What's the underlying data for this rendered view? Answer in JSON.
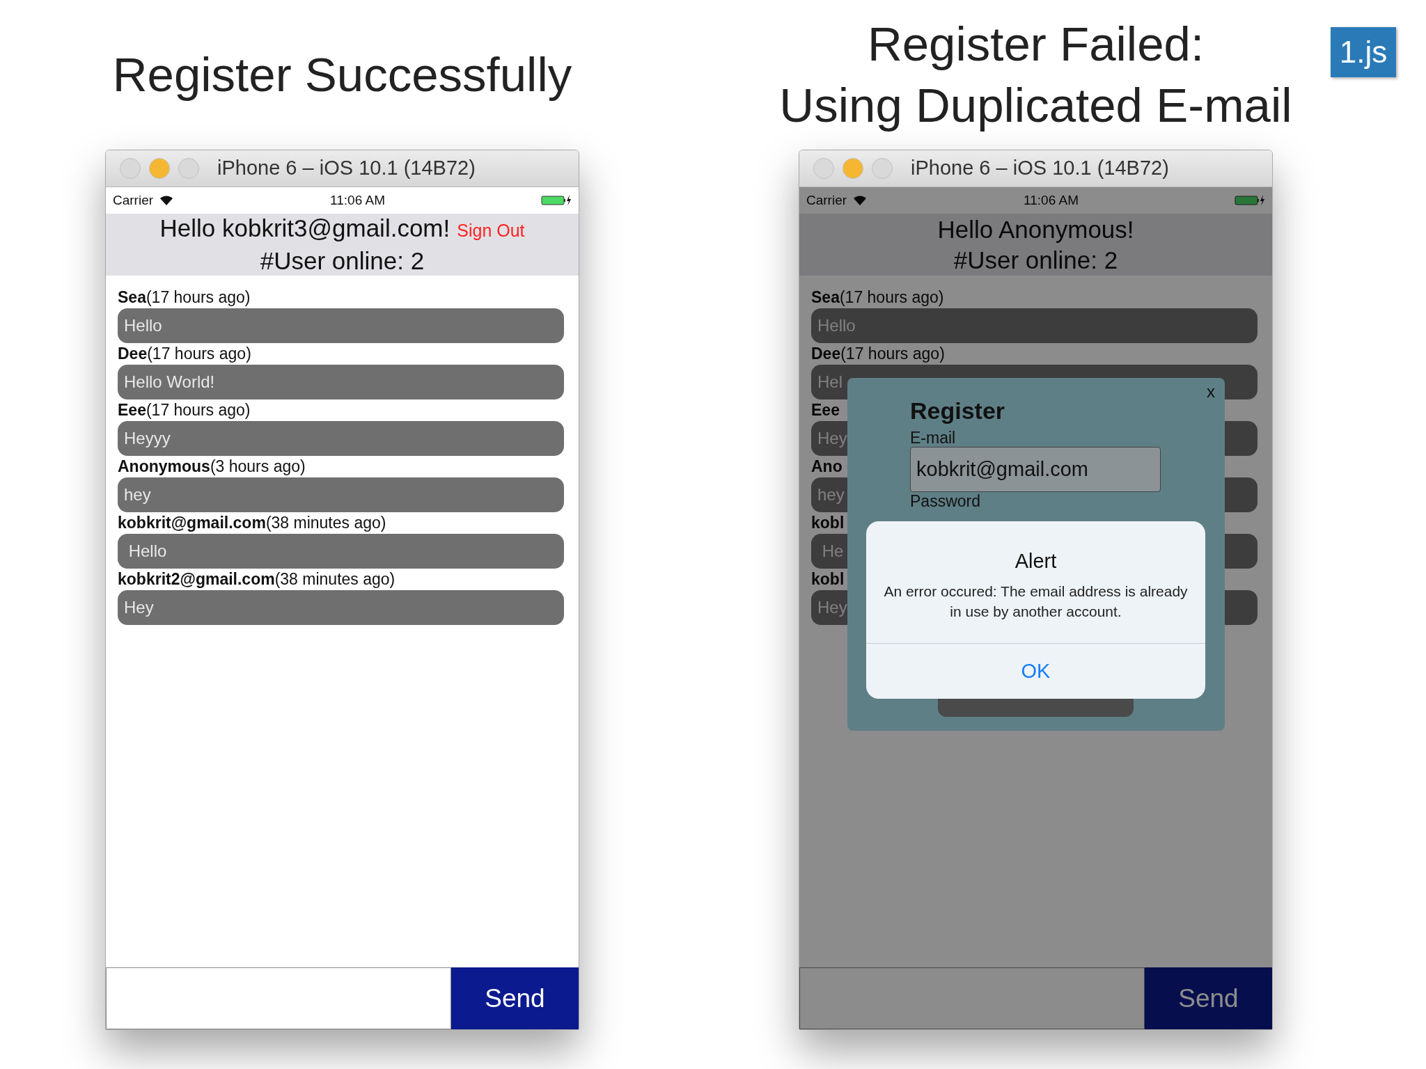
{
  "slide_badge": "1.js",
  "panels": [
    {
      "heading": [
        "Register Successfully"
      ],
      "window_title": "iPhone 6 – iOS 10.1 (14B72)",
      "status": {
        "carrier": "Carrier",
        "time": "11:06 AM"
      },
      "header": {
        "greeting": "Hello kobkrit3@gmail.com!",
        "sign_out": "Sign Out",
        "online": "#User online: 2"
      },
      "messages": [
        {
          "name": "Sea",
          "time": "(17 hours ago)",
          "text": "Hello"
        },
        {
          "name": "Dee",
          "time": "(17 hours ago)",
          "text": "Hello World!"
        },
        {
          "name": "Eee",
          "time": "(17 hours ago)",
          "text": "Heyyy"
        },
        {
          "name": "Anonymous",
          "time": "(3 hours ago)",
          "text": "hey"
        },
        {
          "name": "kobkrit@gmail.com",
          "time": "(38 minutes ago)",
          "text": " Hello"
        },
        {
          "name": "kobkrit2@gmail.com",
          "time": "(38 minutes ago)",
          "text": "Hey"
        }
      ],
      "send": "Send",
      "dimmed": false
    },
    {
      "heading": [
        "Register Failed:",
        "Using Duplicated E-mail"
      ],
      "window_title": "iPhone 6 – iOS 10.1 (14B72)",
      "status": {
        "carrier": "Carrier",
        "time": "11:06 AM"
      },
      "header": {
        "greeting": "Hello Anonymous!",
        "online": "#User online: 2"
      },
      "messages": [
        {
          "name": "Sea",
          "time": "(17 hours ago)",
          "text": "Hello"
        },
        {
          "name": "Dee",
          "time": "(17 hours ago)",
          "text": "Hel"
        },
        {
          "name": "Eee",
          "text": "Hey"
        },
        {
          "name": "Ano",
          "text": "hey"
        },
        {
          "name": "kobl",
          "text": " He"
        },
        {
          "name": "kobl",
          "text": "Hey"
        }
      ],
      "send": "Send",
      "dimmed": true,
      "register_dialog": {
        "close": "x",
        "title": "Register",
        "email_label": "E-mail",
        "email_value": "kobkrit@gmail.com",
        "password_label": "Password"
      },
      "alert": {
        "title": "Alert",
        "message": "An error occured: The email address is already in use by another account.",
        "button": "OK"
      }
    }
  ]
}
